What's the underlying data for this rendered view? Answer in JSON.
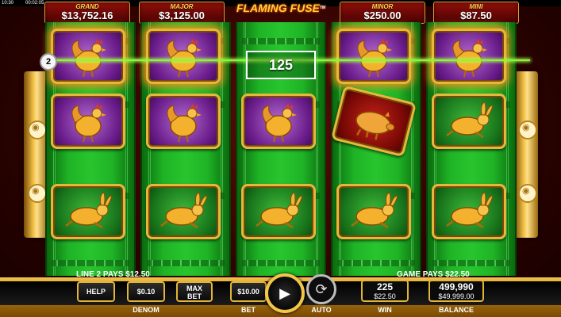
{
  "status": {
    "clock": "10:30",
    "timer": "00:02:05"
  },
  "jackpots": [
    {
      "label": "GRAND",
      "value": "$13,752.16"
    },
    {
      "label": "MAJOR",
      "value": "$3,125.00"
    },
    {
      "label": "MINOR",
      "value": "$250.00"
    },
    {
      "label": "MINI",
      "value": "$87.50"
    }
  ],
  "logo": {
    "title": "FLAMING FUSE",
    "subtitle": "",
    "tm": "TM"
  },
  "reels": [
    [
      "rooster",
      "rooster",
      "rabbit"
    ],
    [
      "rooster",
      "rooster",
      "rabbit"
    ],
    [
      "win",
      "rooster",
      "rabbit"
    ],
    [
      "rooster",
      "pig",
      "rabbit"
    ],
    [
      "rooster",
      "rabbit",
      "rabbit"
    ]
  ],
  "symbol_icons": {
    "rooster": "golden-rooster-icon",
    "rabbit": "golden-rabbit-icon",
    "pig": "golden-pig-icon"
  },
  "win": {
    "line_number": "2",
    "amount": "125"
  },
  "messages": {
    "line_pays": "LINE 2 PAYS $12.50",
    "game_pays": "GAME PAYS $22.50"
  },
  "controls": {
    "help": "HELP",
    "denom_value": "$0.10",
    "denom_label": "DENOM",
    "max_bet_line1": "MAX",
    "max_bet_line2": "BET",
    "bet_value": "$10.00",
    "bet_label": "BET",
    "play_icon": "▶",
    "auto_icon": "⟳",
    "auto_label": "AUTO",
    "win_credits": "225",
    "win_amount": "$22.50",
    "win_label": "WIN",
    "balance_credits": "499,990",
    "balance_amount": "$49,999.00",
    "balance_label": "BALANCE"
  },
  "colors": {
    "payline": "#7dff2c",
    "gold": "#e3b437",
    "reel_green": "#1fb326"
  }
}
